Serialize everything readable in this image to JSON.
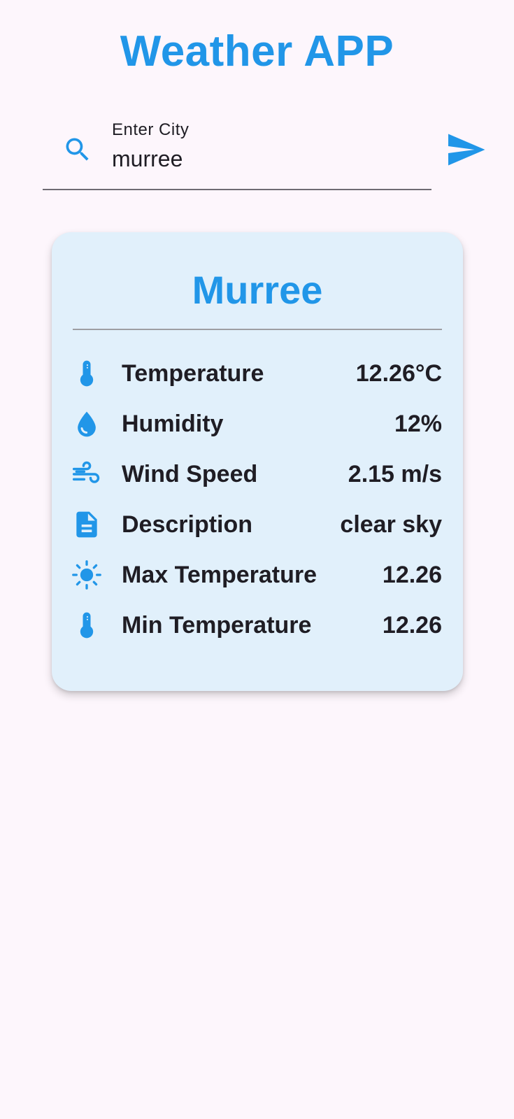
{
  "app": {
    "title": "Weather APP"
  },
  "search": {
    "label": "Enter City",
    "value": "murree",
    "icon": "search-icon",
    "send_icon": "send-icon"
  },
  "card": {
    "city": "Murree",
    "rows": [
      {
        "icon": "thermometer-icon",
        "label": "Temperature",
        "value": "12.26°C"
      },
      {
        "icon": "water-drop-icon",
        "label": "Humidity",
        "value": "12%"
      },
      {
        "icon": "wind-icon",
        "label": "Wind Speed",
        "value": "2.15 m/s"
      },
      {
        "icon": "document-icon",
        "label": "Description",
        "value": "clear sky"
      },
      {
        "icon": "sun-icon",
        "label": "Max Temperature",
        "value": "12.26"
      },
      {
        "icon": "thermometer-icon",
        "label": "Min Temperature",
        "value": "12.26"
      }
    ]
  },
  "colors": {
    "accent": "#2196e8",
    "background": "#fdf6fc",
    "card": "#e1f0fb",
    "text": "#1f1d24"
  }
}
